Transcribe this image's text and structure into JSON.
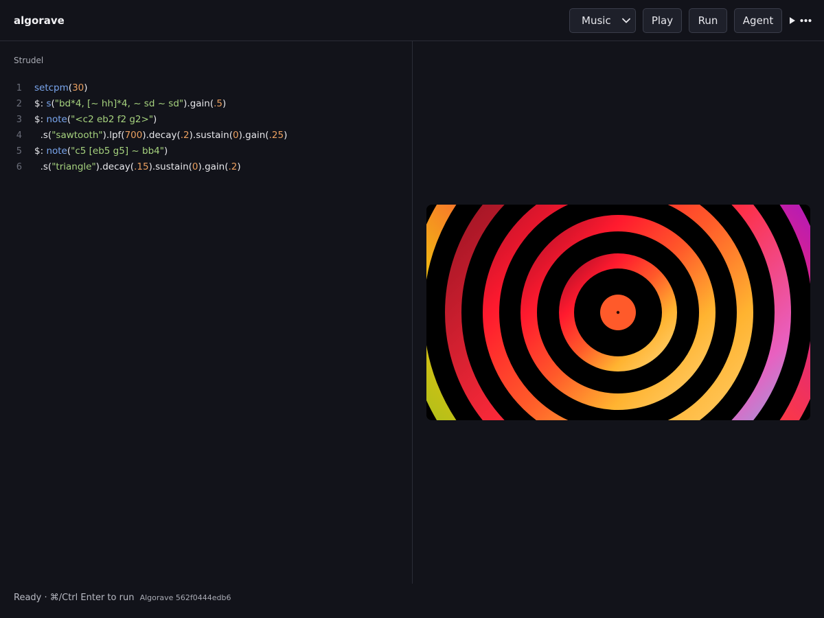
{
  "header": {
    "brand": "algorave",
    "mode_select": {
      "selected": "Music"
    },
    "play_label": "Play",
    "run_label": "Run",
    "agent_label": "Agent",
    "icons": [
      "chevron-down-icon",
      "play-icon",
      "more-icon"
    ]
  },
  "editor": {
    "label": "Strudel",
    "lines": [
      {
        "number": "1",
        "text": "setcpm(30)"
      },
      {
        "number": "2",
        "text": "$: s(\"bd*4, [~ hh]*4, ~ sd ~ sd\").gain(.5)"
      },
      {
        "number": "3",
        "text": "$: note(\"<c2 eb2 f2 g2>\")"
      },
      {
        "number": "4",
        "text": "  .s(\"sawtooth\").lpf(700).decay(.2).sustain(0).gain(.25)"
      },
      {
        "number": "5",
        "text": "$: note(\"c5 [eb5 g5] ~ bb4\")"
      },
      {
        "number": "6",
        "text": "  .s(\"triangle\").decay(.15).sustain(0).gain(.2)"
      }
    ],
    "colors": {
      "function": "#7aa6ee",
      "string": "#a6d27e",
      "number": "#eba060",
      "plain": "#e8e8ec"
    }
  },
  "preview": {
    "visualizer": "concentric-rings-visualization"
  },
  "footer": {
    "status": "Ready · ⌘/Ctrl Enter to run",
    "version": "Algorave 562f0444edb6"
  },
  "colors": {
    "background": "#12131a",
    "border": "#2b2d37",
    "button_bg": "#1e202a"
  }
}
